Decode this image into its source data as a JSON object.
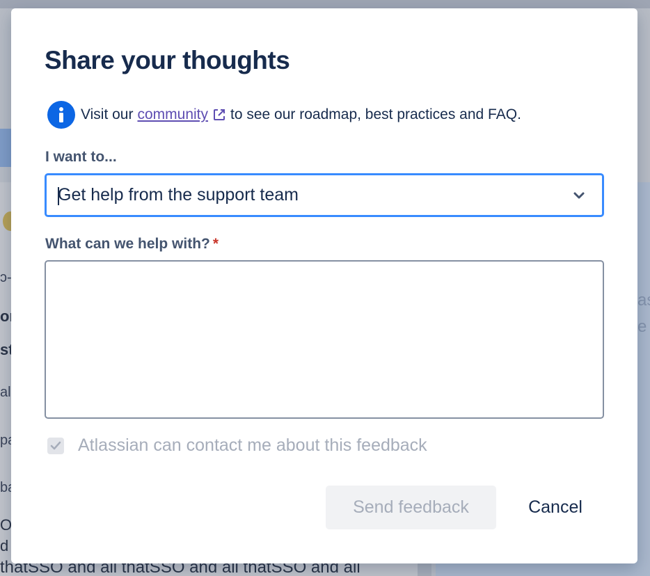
{
  "background": {
    "left_fragments": [
      "ɔ-",
      "or",
      "st",
      "al",
      "pa",
      "ba",
      "O",
      "d a"
    ],
    "right_fragments": [
      "as",
      "e t"
    ],
    "bottom_text": "thatSSO and all thatSSO and all thatSSO and all"
  },
  "modal": {
    "title": "Share your thoughts",
    "info": {
      "icon": "info-icon",
      "prefix": "Visit our",
      "link_text": "community",
      "link_icon": "external-link-icon",
      "suffix": "to see our roadmap, best practices and FAQ."
    },
    "intent": {
      "label": "I want to...",
      "selected": "Get help from the support team"
    },
    "details": {
      "label": "What can we help with?",
      "required_mark": "*",
      "value": ""
    },
    "contact": {
      "label": "Atlassian can contact me about this feedback",
      "checked": true
    },
    "actions": {
      "send_label": "Send feedback",
      "cancel_label": "Cancel"
    }
  },
  "colors": {
    "primary_blue": "#0c66e4",
    "focus_border": "#388bff",
    "text": "#172b4d",
    "link": "#5e4db2",
    "required": "#c9372c"
  }
}
